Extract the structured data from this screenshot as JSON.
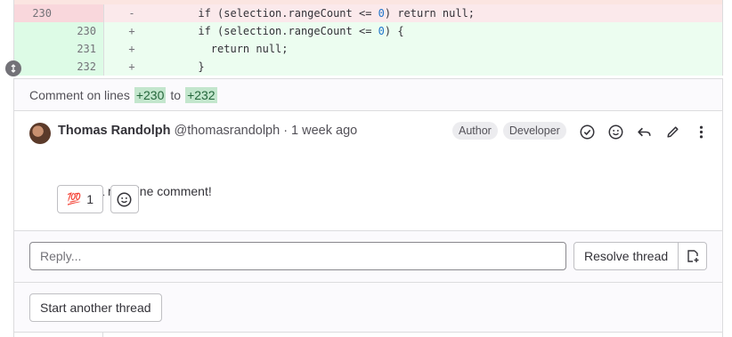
{
  "diff": {
    "lines": [
      {
        "type": "removed",
        "old": "230",
        "new": "",
        "marker": "-",
        "code_prefix": "      if (selection.rangeCount <= ",
        "code_num": "0",
        "code_suffix": ") return null;"
      },
      {
        "type": "added",
        "old": "",
        "new": "230",
        "marker": "+",
        "code_prefix": "      if (selection.rangeCount <= ",
        "code_num": "0",
        "code_suffix": ") {"
      },
      {
        "type": "added",
        "old": "",
        "new": "231",
        "marker": "+",
        "code_prefix": "        return null;",
        "code_num": "",
        "code_suffix": ""
      },
      {
        "type": "added",
        "old": "",
        "new": "232",
        "marker": "+",
        "code_prefix": "      }",
        "code_num": "",
        "code_suffix": ""
      }
    ]
  },
  "thread": {
    "comment_on": "Comment on lines",
    "from_line": "+230",
    "to_word": "to",
    "to_line": "+232"
  },
  "note": {
    "author_name": "Thomas Randolph",
    "author_handle": "@thomasrandolph",
    "separator": "·",
    "time": "1 week ago",
    "badges": [
      "Author",
      "Developer"
    ],
    "body": "This is a multiline comment!",
    "award_emoji": "💯",
    "award_count": "1"
  },
  "reply": {
    "placeholder": "Reply...",
    "resolve_label": "Resolve thread"
  },
  "start_another_label": "Start another thread",
  "icons": {
    "resolve": "check-circle-icon",
    "emoji": "smile-icon",
    "reply": "reply-icon",
    "edit": "pencil-icon",
    "more": "ellipsis-v-icon",
    "issue": "issue-new-icon",
    "expand": "expand-icon"
  }
}
